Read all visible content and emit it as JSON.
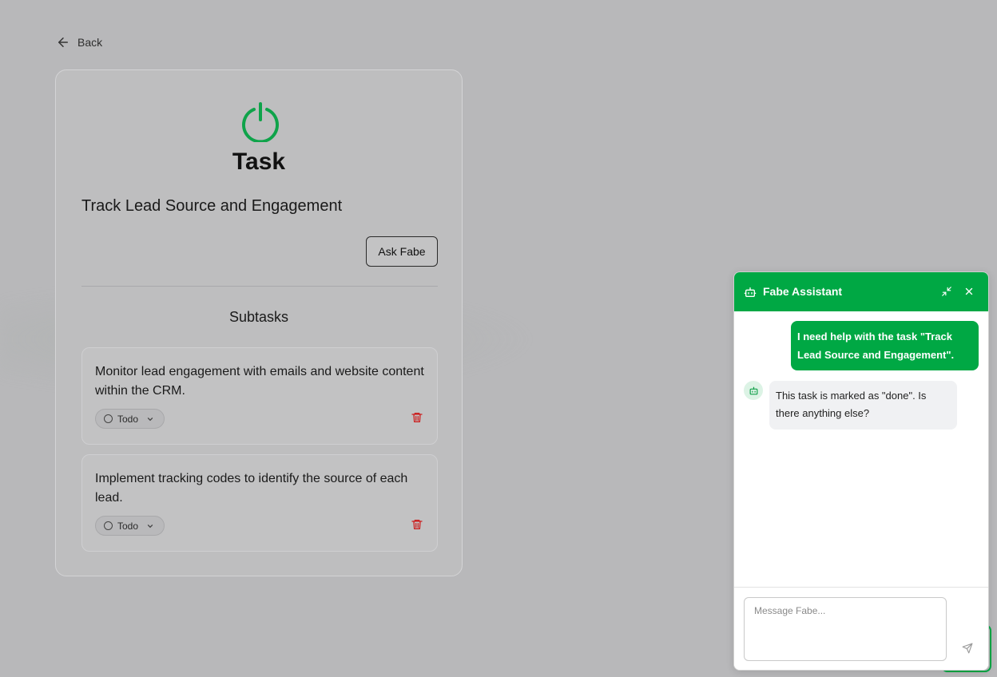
{
  "nav": {
    "back_label": "Back",
    "back_icon": "arrow-left-icon"
  },
  "task": {
    "icon": "power-icon",
    "heading": "Task",
    "title": "Track Lead Source and Engagement",
    "ask_button_label": "Ask Fabe",
    "subtasks_heading": "Subtasks",
    "subtasks": [
      {
        "text": "Monitor lead engagement with emails and website content within the CRM.",
        "status": "Todo"
      },
      {
        "text": "Implement tracking codes to identify the source of each lead.",
        "status": "Todo"
      }
    ]
  },
  "chat": {
    "title": "Fabe Assistant",
    "messages": [
      {
        "role": "user",
        "text": "I need help with the task \"Track Lead Source and Engagement\"."
      },
      {
        "role": "assistant",
        "text": "This task is marked as \"done\". Is there anything else?"
      }
    ],
    "input": {
      "placeholder": "Message Fabe...",
      "value": ""
    }
  },
  "colors": {
    "accent": "#00a844",
    "danger": "#cc1f1f",
    "overlay_background": "#b8b8ba"
  }
}
